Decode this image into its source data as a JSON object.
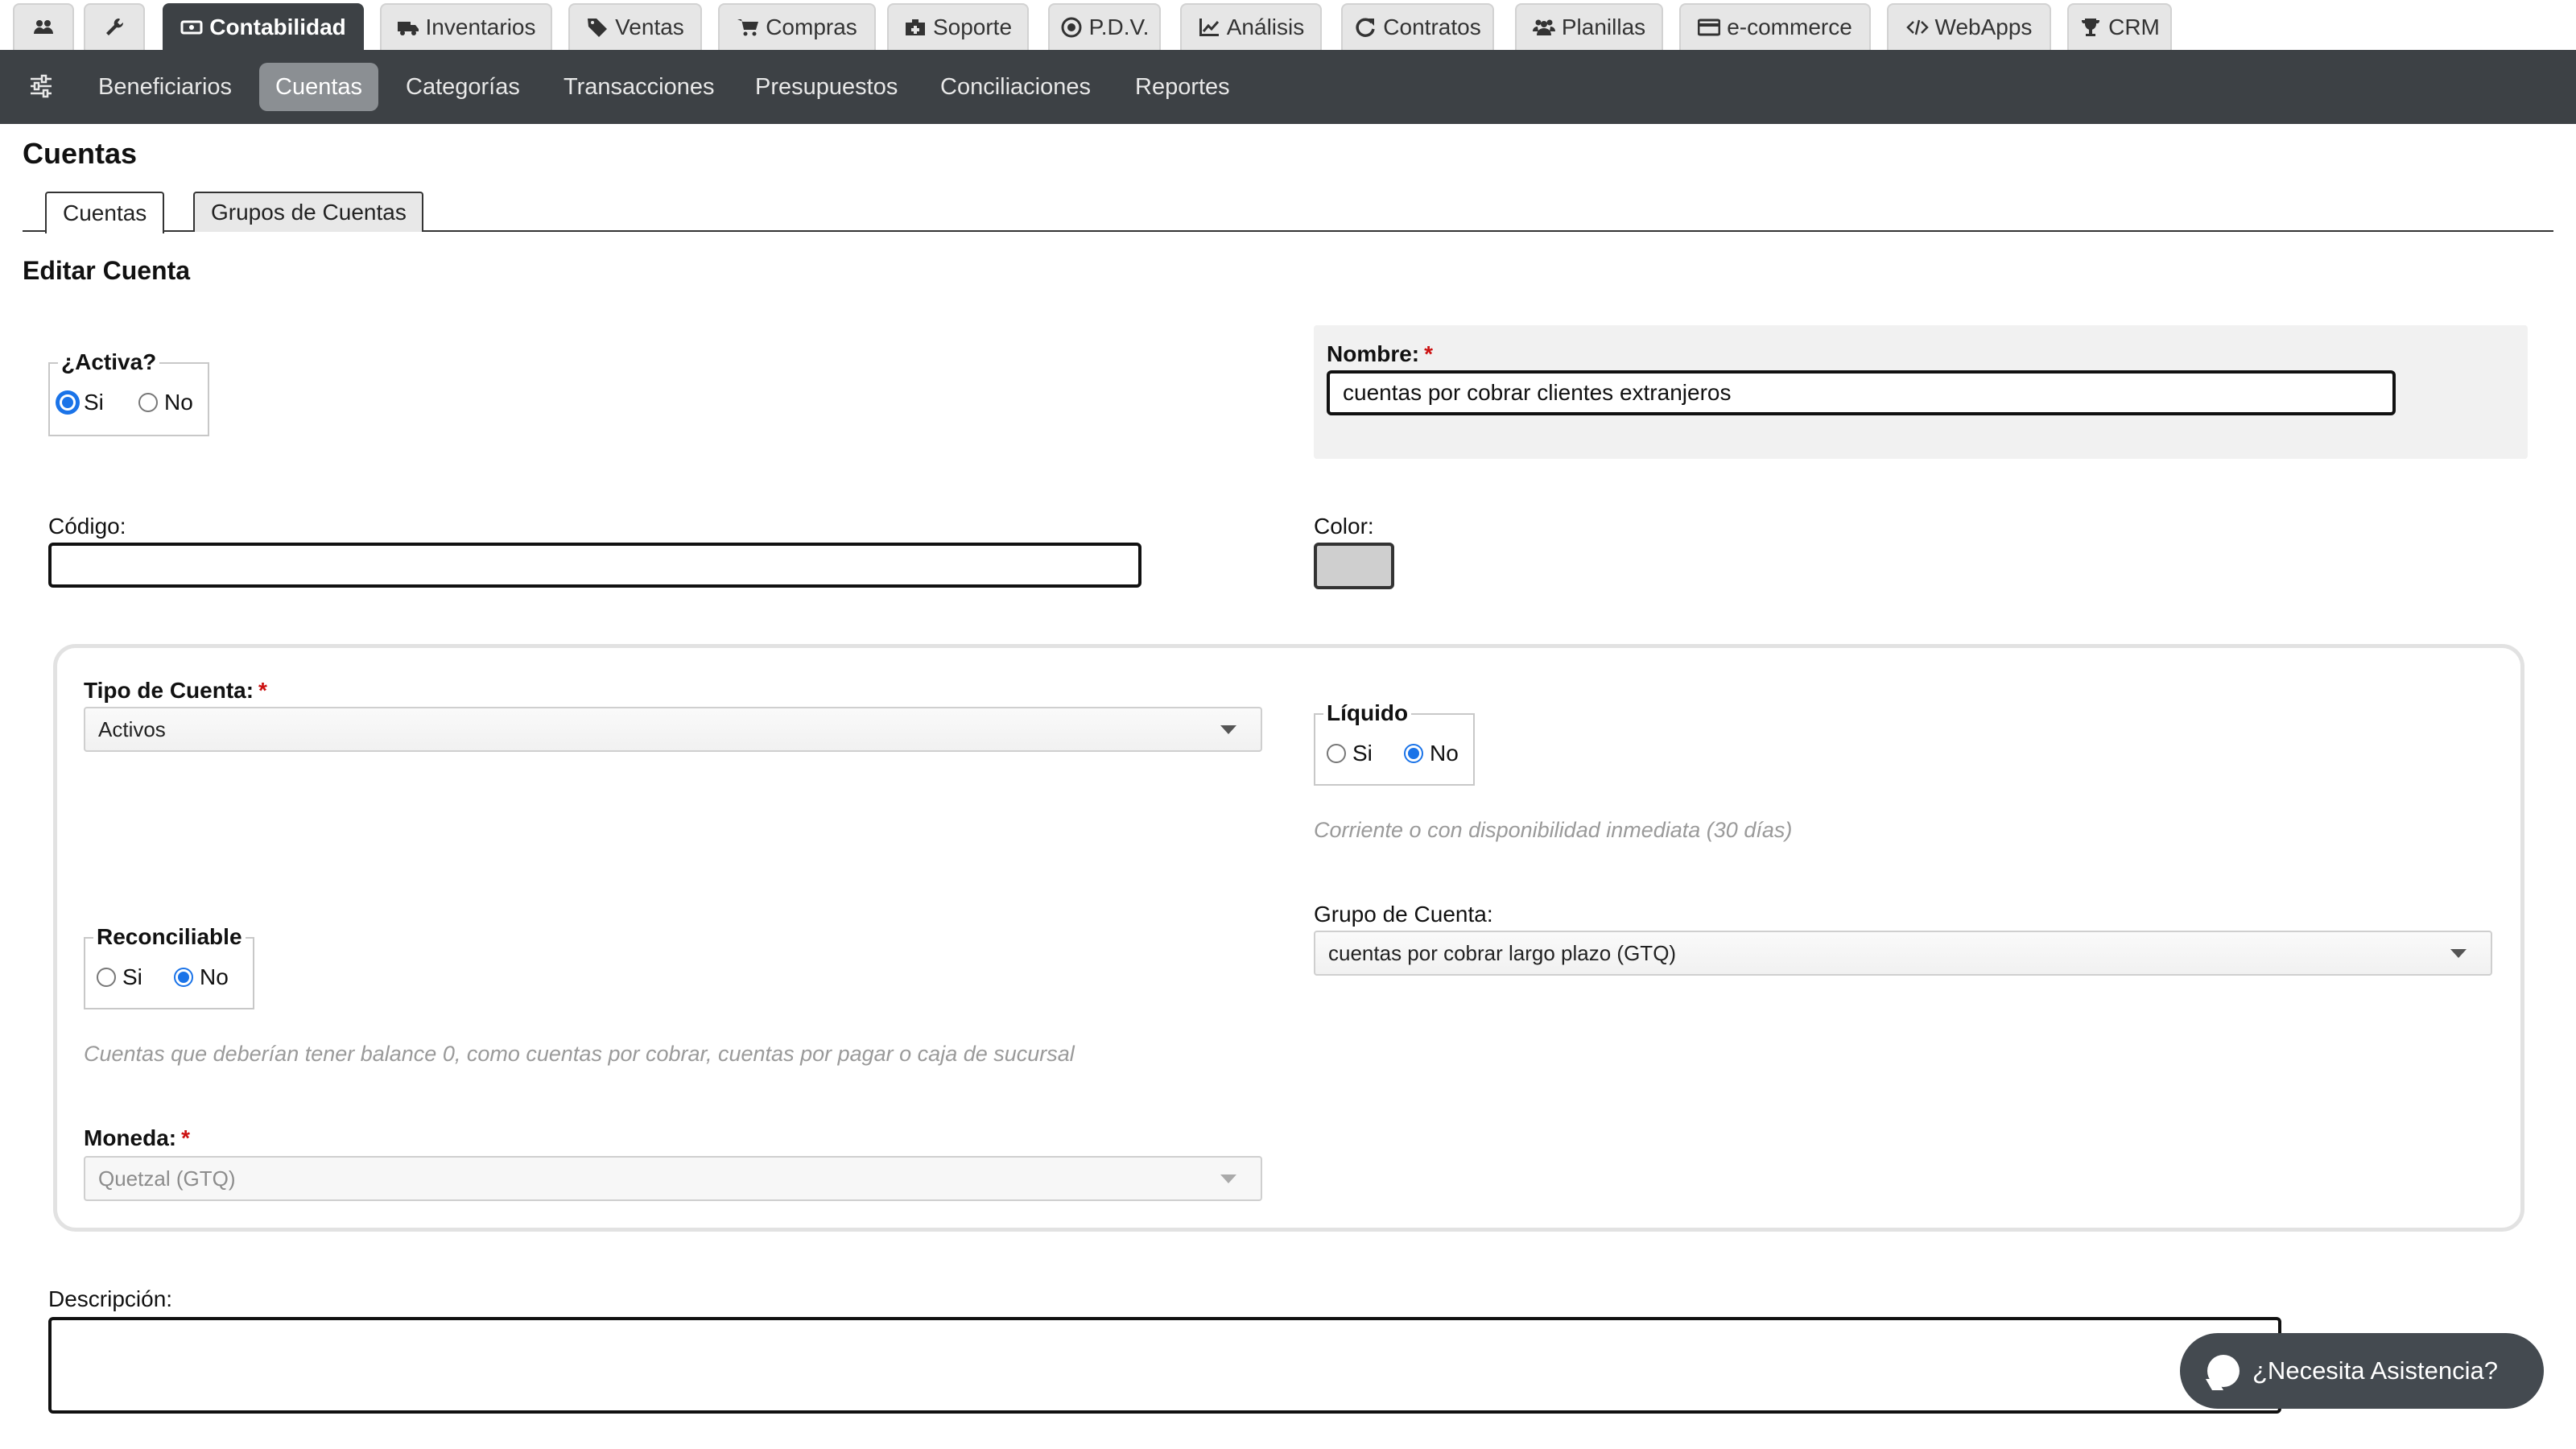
{
  "module_tabs": [
    {
      "label": "",
      "icon": "users-icon"
    },
    {
      "label": "",
      "icon": "wrench-icon"
    },
    {
      "label": "Contabilidad",
      "icon": "money-icon",
      "active": true
    },
    {
      "label": "Inventarios",
      "icon": "truck-icon"
    },
    {
      "label": "Ventas",
      "icon": "tag-icon"
    },
    {
      "label": "Compras",
      "icon": "cart-icon"
    },
    {
      "label": "Soporte",
      "icon": "medkit-icon"
    },
    {
      "label": "P.D.V.",
      "icon": "target-icon"
    },
    {
      "label": "Análisis",
      "icon": "chart-icon"
    },
    {
      "label": "Contratos",
      "icon": "refresh-icon"
    },
    {
      "label": "Planillas",
      "icon": "group-icon"
    },
    {
      "label": "e-commerce",
      "icon": "card-icon"
    },
    {
      "label": "WebApps",
      "icon": "code-icon"
    },
    {
      "label": "CRM",
      "icon": "trophy-icon"
    }
  ],
  "subnav": {
    "icon": "sliders-icon",
    "items": [
      {
        "label": "Beneficiarios"
      },
      {
        "label": "Cuentas",
        "active": true
      },
      {
        "label": "Categorías"
      },
      {
        "label": "Transacciones"
      },
      {
        "label": "Presupuestos"
      },
      {
        "label": "Conciliaciones"
      },
      {
        "label": "Reportes"
      }
    ]
  },
  "page": {
    "title": "Cuentas",
    "tabs": [
      {
        "label": "Cuentas",
        "active": true
      },
      {
        "label": "Grupos de Cuentas"
      }
    ],
    "section_title": "Editar Cuenta"
  },
  "form": {
    "activa": {
      "legend": "¿Activa?",
      "options": [
        "Si",
        "No"
      ],
      "selected": "Si"
    },
    "nombre": {
      "label": "Nombre:",
      "required": "*",
      "value": "cuentas por cobrar clientes extranjeros"
    },
    "codigo": {
      "label": "Código:",
      "value": ""
    },
    "color": {
      "label": "Color:",
      "value": "#cfcfcf"
    },
    "tipo": {
      "label": "Tipo de Cuenta:",
      "required": "*",
      "value": "Activos"
    },
    "liquido": {
      "legend": "Líquido",
      "options": [
        "Si",
        "No"
      ],
      "selected": "No",
      "hint": "Corriente o con disponibilidad inmediata (30 días)"
    },
    "grupo": {
      "label": "Grupo de Cuenta:",
      "value": "cuentas por cobrar largo plazo (GTQ)"
    },
    "reconciliable": {
      "legend": "Reconciliable",
      "options": [
        "Si",
        "No"
      ],
      "selected": "No",
      "hint": "Cuentas que deberían tener balance 0, como cuentas por cobrar, cuentas por pagar o caja de sucursal"
    },
    "moneda": {
      "label": "Moneda:",
      "required": "*",
      "value": "Quetzal (GTQ)",
      "disabled": true
    },
    "descripcion": {
      "label": "Descripción:",
      "value": ""
    }
  },
  "help": {
    "label": "¿Necesita Asistencia?",
    "icon": "chat-bubble-icon"
  },
  "colors": {
    "dark_bar": "#3d4145",
    "active_subitem": "#8b8f93",
    "radio_accent": "#1a73e8",
    "required": "#cc1111"
  }
}
